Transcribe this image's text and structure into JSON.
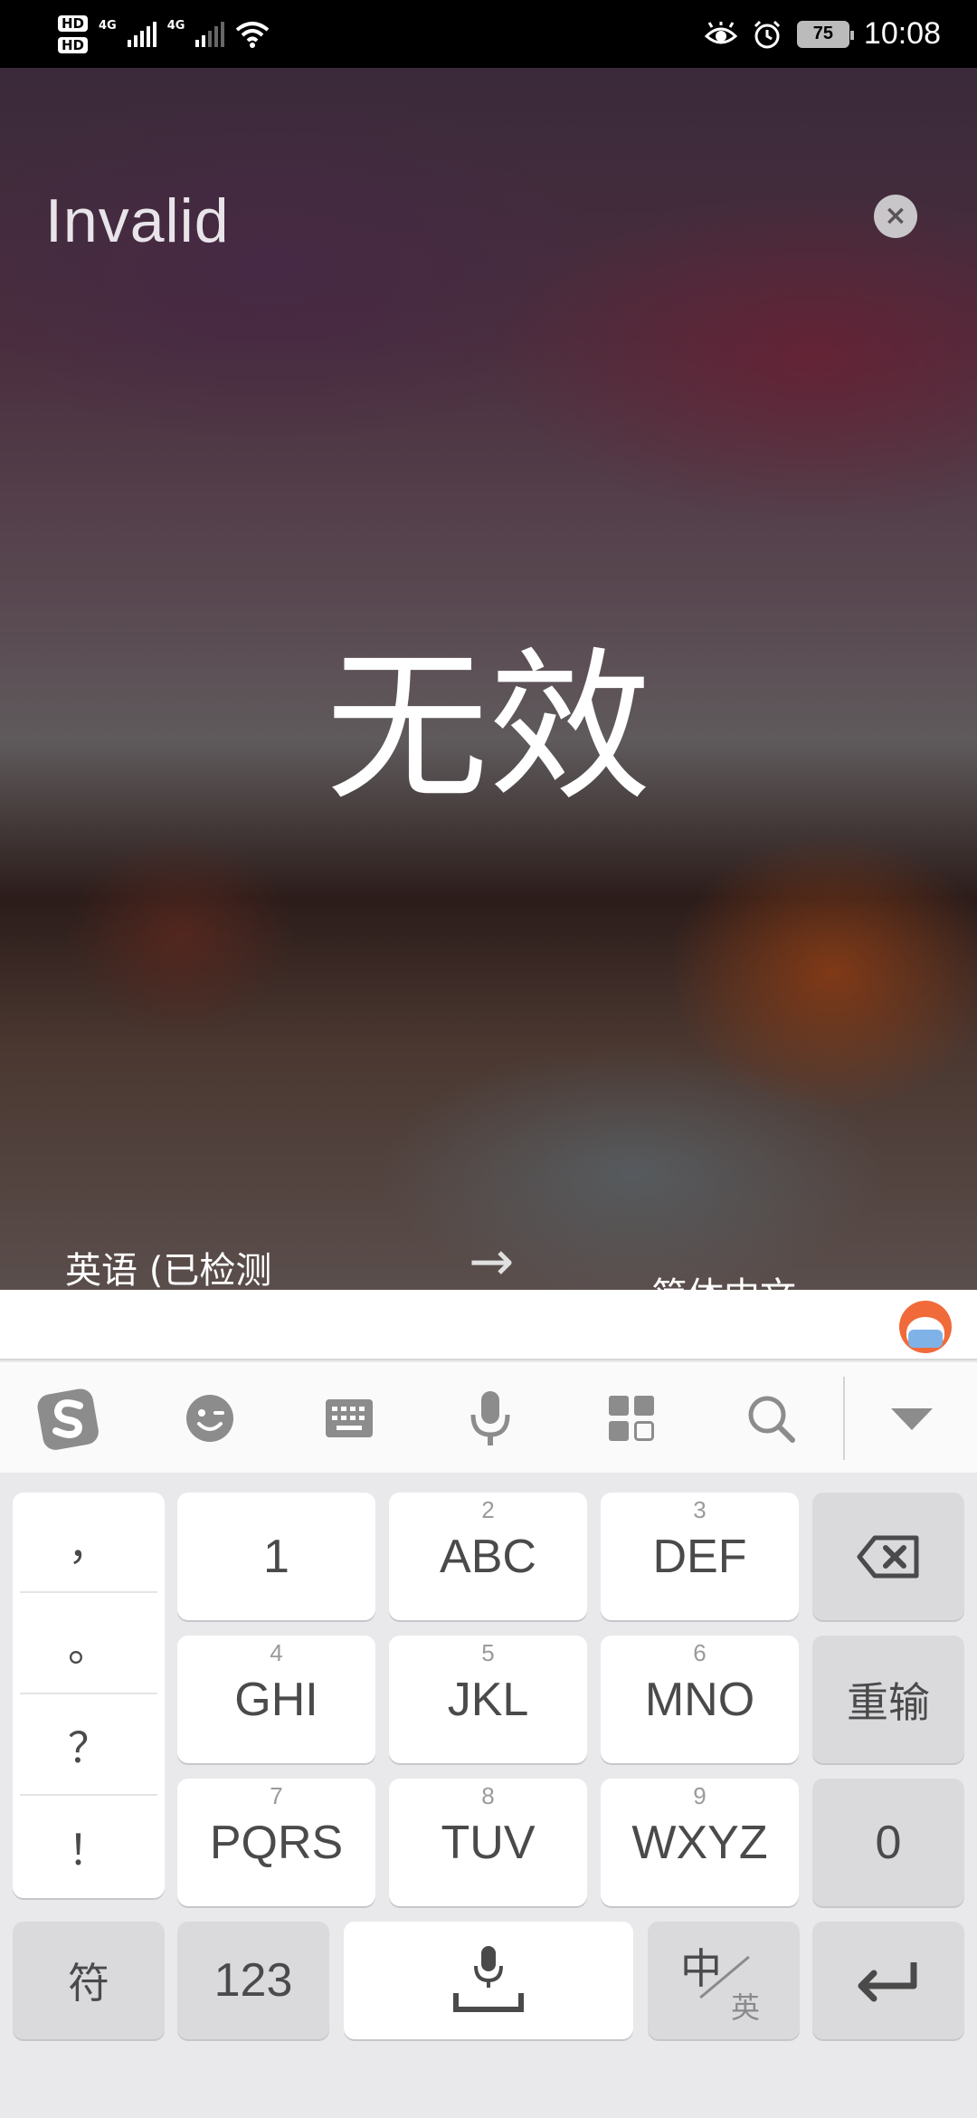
{
  "status_bar": {
    "hd1": "HD",
    "hd2": "HD",
    "sim1_network": "4G",
    "sim2_network": "4G",
    "battery_percent": "75",
    "time": "10:08"
  },
  "translation": {
    "source_text": "Invalid",
    "translated_text": "无效",
    "close_label": "×",
    "source_language": "英语 (已检测",
    "arrow": "→",
    "target_language": "简体中文"
  },
  "keyboard": {
    "toolbar_icons": [
      "sogou-logo-icon",
      "emoji-icon",
      "keyboard-icon",
      "microphone-icon",
      "apps-grid-icon",
      "search-icon",
      "collapse-keyboard-icon"
    ],
    "punctuation": [
      "，",
      "。",
      "？",
      "！"
    ],
    "keys": {
      "k1": {
        "main": "1",
        "sub": ""
      },
      "k2": {
        "main": "ABC",
        "sub": "2"
      },
      "k3": {
        "main": "DEF",
        "sub": "3"
      },
      "k4": {
        "main": "GHI",
        "sub": "4"
      },
      "k5": {
        "main": "JKL",
        "sub": "5"
      },
      "k6": {
        "main": "MNO",
        "sub": "6"
      },
      "k7": {
        "main": "PQRS",
        "sub": "7"
      },
      "k8": {
        "main": "TUV",
        "sub": "8"
      },
      "k9": {
        "main": "WXYZ",
        "sub": "9"
      }
    },
    "reinput": "重输",
    "zero": "0",
    "symbol": "符",
    "numeric": "123",
    "lang_switch_main": "中",
    "lang_switch_sub": "英"
  }
}
